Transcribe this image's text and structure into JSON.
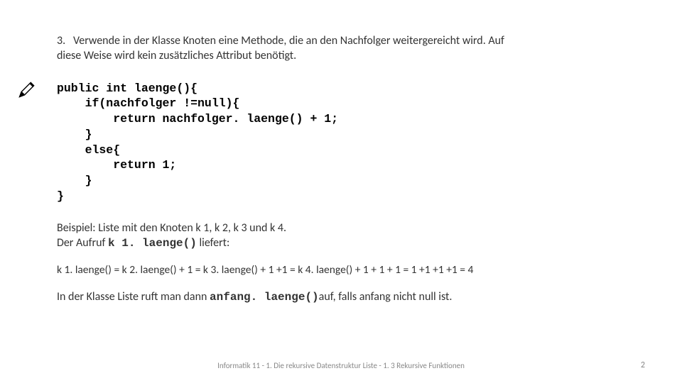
{
  "intro": {
    "number": "3.",
    "text_a": "Verwende in der Klasse Knoten eine Methode, die an den Nachfolger weitergereicht wird. Auf",
    "text_b": "diese Weise wird kein zusätzliches Attribut benötigt."
  },
  "code": "public int laenge(){\n    if(nachfolger !=null){\n        return nachfolger. laenge() + 1;\n    }\n    else{\n        return 1;\n    }\n}",
  "example": {
    "line1_a": "Beispiel:   Liste mit den Knoten k 1, k 2, k 3 und k 4.",
    "line2_a": "Der Aufruf ",
    "line2_code": "k 1. laenge()",
    "line2_b": "   liefert:"
  },
  "chain": "k 1. laenge() = k 2. laenge() + 1  = k 3. laenge() + 1 +1 = k 4. laenge() + 1 + 1 + 1 = 1 +1 +1 +1 = 4",
  "note": {
    "a": "In der Klasse Liste ruft man dann ",
    "code": "anfang. laenge()",
    "b": "auf, falls anfang nicht null ist."
  },
  "footer": {
    "center": "Informatik 11 - 1. Die rekursive Datenstruktur Liste - 1. 3 Rekursive Funktionen",
    "page": "2"
  },
  "icons": {
    "pencil": "pencil-icon"
  }
}
